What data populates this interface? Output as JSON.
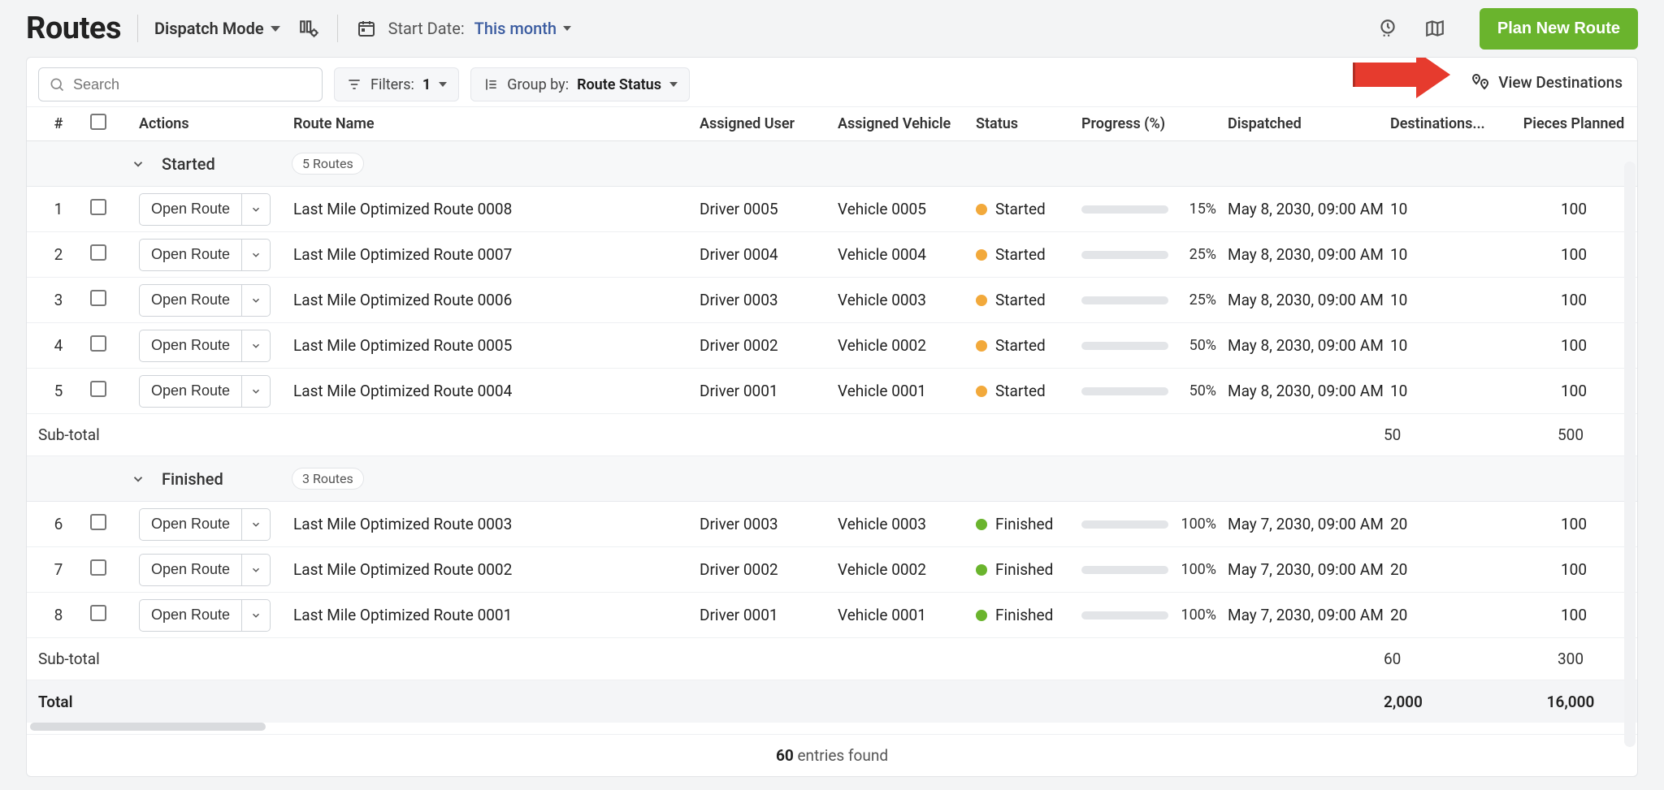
{
  "header": {
    "title": "Routes",
    "mode_label": "Dispatch Mode",
    "start_date_label": "Start Date:",
    "start_date_value": "This month",
    "plan_button": "Plan New Route"
  },
  "toolbar": {
    "search_placeholder": "Search",
    "filters_label": "Filters:",
    "filters_count": "1",
    "group_by_label": "Group by:",
    "group_by_value": "Route Status",
    "view_destinations": "View Destinations"
  },
  "columns": {
    "index": "#",
    "actions": "Actions",
    "route_name": "Route Name",
    "assigned_user": "Assigned User",
    "assigned_vehicle": "Assigned Vehicle",
    "status": "Status",
    "progress": "Progress (%)",
    "dispatched": "Dispatched",
    "destinations": "Destinations...",
    "pieces_planned": "Pieces Planned"
  },
  "open_route_label": "Open Route",
  "groups": [
    {
      "name": "Started",
      "badge": "5 Routes",
      "rows": [
        {
          "idx": "1",
          "name": "Last Mile Optimized Route 0008",
          "user": "Driver 0005",
          "vehicle": "Vehicle 0005",
          "status": "Started",
          "status_kind": "started",
          "progress": 15,
          "dispatched": "May 8, 2030, 09:00 AM",
          "destinations": "10",
          "pieces": "100"
        },
        {
          "idx": "2",
          "name": "Last Mile Optimized Route 0007",
          "user": "Driver 0004",
          "vehicle": "Vehicle 0004",
          "status": "Started",
          "status_kind": "started",
          "progress": 25,
          "dispatched": "May 8, 2030, 09:00 AM",
          "destinations": "10",
          "pieces": "100"
        },
        {
          "idx": "3",
          "name": "Last Mile Optimized Route 0006",
          "user": "Driver 0003",
          "vehicle": "Vehicle 0003",
          "status": "Started",
          "status_kind": "started",
          "progress": 25,
          "dispatched": "May 8, 2030, 09:00 AM",
          "destinations": "10",
          "pieces": "100"
        },
        {
          "idx": "4",
          "name": "Last Mile Optimized Route 0005",
          "user": "Driver 0002",
          "vehicle": "Vehicle 0002",
          "status": "Started",
          "status_kind": "started",
          "progress": 50,
          "dispatched": "May 8, 2030, 09:00 AM",
          "destinations": "10",
          "pieces": "100"
        },
        {
          "idx": "5",
          "name": "Last Mile Optimized Route 0004",
          "user": "Driver 0001",
          "vehicle": "Vehicle 0001",
          "status": "Started",
          "status_kind": "started",
          "progress": 50,
          "dispatched": "May 8, 2030, 09:00 AM",
          "destinations": "10",
          "pieces": "100"
        }
      ],
      "subtotal": {
        "label": "Sub-total",
        "destinations": "50",
        "pieces": "500"
      }
    },
    {
      "name": "Finished",
      "badge": "3 Routes",
      "rows": [
        {
          "idx": "6",
          "name": "Last Mile Optimized Route 0003",
          "user": "Driver 0003",
          "vehicle": "Vehicle 0003",
          "status": "Finished",
          "status_kind": "finished",
          "progress": 100,
          "dispatched": "May 7, 2030, 09:00 AM",
          "destinations": "20",
          "pieces": "100"
        },
        {
          "idx": "7",
          "name": "Last Mile Optimized Route 0002",
          "user": "Driver 0002",
          "vehicle": "Vehicle 0002",
          "status": "Finished",
          "status_kind": "finished",
          "progress": 100,
          "dispatched": "May 7, 2030, 09:00 AM",
          "destinations": "20",
          "pieces": "100"
        },
        {
          "idx": "8",
          "name": "Last Mile Optimized Route 0001",
          "user": "Driver 0001",
          "vehicle": "Vehicle 0001",
          "status": "Finished",
          "status_kind": "finished",
          "progress": 100,
          "dispatched": "May 7, 2030, 09:00 AM",
          "destinations": "20",
          "pieces": "100"
        }
      ],
      "subtotal": {
        "label": "Sub-total",
        "destinations": "60",
        "pieces": "300"
      }
    }
  ],
  "total": {
    "label": "Total",
    "destinations": "2,000",
    "pieces": "16,000"
  },
  "footer": {
    "count": "60",
    "suffix": " entries found"
  }
}
